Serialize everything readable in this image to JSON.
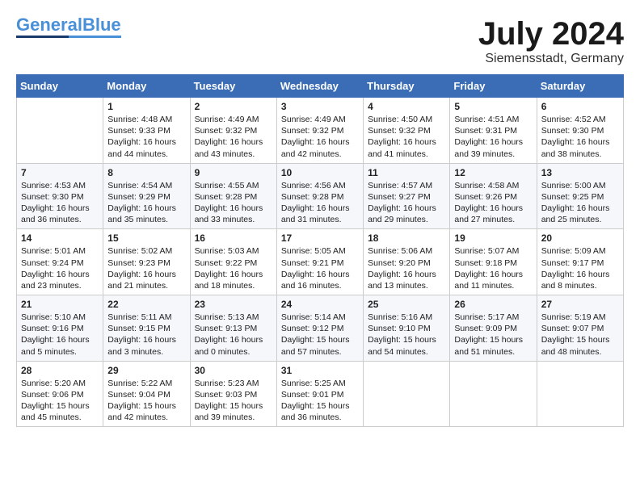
{
  "logo": {
    "part1": "General",
    "part2": "Blue"
  },
  "title": "July 2024",
  "location": "Siemensstadt, Germany",
  "headers": [
    "Sunday",
    "Monday",
    "Tuesday",
    "Wednesday",
    "Thursday",
    "Friday",
    "Saturday"
  ],
  "weeks": [
    [
      {
        "day": "",
        "lines": []
      },
      {
        "day": "1",
        "lines": [
          "Sunrise: 4:48 AM",
          "Sunset: 9:33 PM",
          "Daylight: 16 hours",
          "and 44 minutes."
        ]
      },
      {
        "day": "2",
        "lines": [
          "Sunrise: 4:49 AM",
          "Sunset: 9:32 PM",
          "Daylight: 16 hours",
          "and 43 minutes."
        ]
      },
      {
        "day": "3",
        "lines": [
          "Sunrise: 4:49 AM",
          "Sunset: 9:32 PM",
          "Daylight: 16 hours",
          "and 42 minutes."
        ]
      },
      {
        "day": "4",
        "lines": [
          "Sunrise: 4:50 AM",
          "Sunset: 9:32 PM",
          "Daylight: 16 hours",
          "and 41 minutes."
        ]
      },
      {
        "day": "5",
        "lines": [
          "Sunrise: 4:51 AM",
          "Sunset: 9:31 PM",
          "Daylight: 16 hours",
          "and 39 minutes."
        ]
      },
      {
        "day": "6",
        "lines": [
          "Sunrise: 4:52 AM",
          "Sunset: 9:30 PM",
          "Daylight: 16 hours",
          "and 38 minutes."
        ]
      }
    ],
    [
      {
        "day": "7",
        "lines": [
          "Sunrise: 4:53 AM",
          "Sunset: 9:30 PM",
          "Daylight: 16 hours",
          "and 36 minutes."
        ]
      },
      {
        "day": "8",
        "lines": [
          "Sunrise: 4:54 AM",
          "Sunset: 9:29 PM",
          "Daylight: 16 hours",
          "and 35 minutes."
        ]
      },
      {
        "day": "9",
        "lines": [
          "Sunrise: 4:55 AM",
          "Sunset: 9:28 PM",
          "Daylight: 16 hours",
          "and 33 minutes."
        ]
      },
      {
        "day": "10",
        "lines": [
          "Sunrise: 4:56 AM",
          "Sunset: 9:28 PM",
          "Daylight: 16 hours",
          "and 31 minutes."
        ]
      },
      {
        "day": "11",
        "lines": [
          "Sunrise: 4:57 AM",
          "Sunset: 9:27 PM",
          "Daylight: 16 hours",
          "and 29 minutes."
        ]
      },
      {
        "day": "12",
        "lines": [
          "Sunrise: 4:58 AM",
          "Sunset: 9:26 PM",
          "Daylight: 16 hours",
          "and 27 minutes."
        ]
      },
      {
        "day": "13",
        "lines": [
          "Sunrise: 5:00 AM",
          "Sunset: 9:25 PM",
          "Daylight: 16 hours",
          "and 25 minutes."
        ]
      }
    ],
    [
      {
        "day": "14",
        "lines": [
          "Sunrise: 5:01 AM",
          "Sunset: 9:24 PM",
          "Daylight: 16 hours",
          "and 23 minutes."
        ]
      },
      {
        "day": "15",
        "lines": [
          "Sunrise: 5:02 AM",
          "Sunset: 9:23 PM",
          "Daylight: 16 hours",
          "and 21 minutes."
        ]
      },
      {
        "day": "16",
        "lines": [
          "Sunrise: 5:03 AM",
          "Sunset: 9:22 PM",
          "Daylight: 16 hours",
          "and 18 minutes."
        ]
      },
      {
        "day": "17",
        "lines": [
          "Sunrise: 5:05 AM",
          "Sunset: 9:21 PM",
          "Daylight: 16 hours",
          "and 16 minutes."
        ]
      },
      {
        "day": "18",
        "lines": [
          "Sunrise: 5:06 AM",
          "Sunset: 9:20 PM",
          "Daylight: 16 hours",
          "and 13 minutes."
        ]
      },
      {
        "day": "19",
        "lines": [
          "Sunrise: 5:07 AM",
          "Sunset: 9:18 PM",
          "Daylight: 16 hours",
          "and 11 minutes."
        ]
      },
      {
        "day": "20",
        "lines": [
          "Sunrise: 5:09 AM",
          "Sunset: 9:17 PM",
          "Daylight: 16 hours",
          "and 8 minutes."
        ]
      }
    ],
    [
      {
        "day": "21",
        "lines": [
          "Sunrise: 5:10 AM",
          "Sunset: 9:16 PM",
          "Daylight: 16 hours",
          "and 5 minutes."
        ]
      },
      {
        "day": "22",
        "lines": [
          "Sunrise: 5:11 AM",
          "Sunset: 9:15 PM",
          "Daylight: 16 hours",
          "and 3 minutes."
        ]
      },
      {
        "day": "23",
        "lines": [
          "Sunrise: 5:13 AM",
          "Sunset: 9:13 PM",
          "Daylight: 16 hours",
          "and 0 minutes."
        ]
      },
      {
        "day": "24",
        "lines": [
          "Sunrise: 5:14 AM",
          "Sunset: 9:12 PM",
          "Daylight: 15 hours",
          "and 57 minutes."
        ]
      },
      {
        "day": "25",
        "lines": [
          "Sunrise: 5:16 AM",
          "Sunset: 9:10 PM",
          "Daylight: 15 hours",
          "and 54 minutes."
        ]
      },
      {
        "day": "26",
        "lines": [
          "Sunrise: 5:17 AM",
          "Sunset: 9:09 PM",
          "Daylight: 15 hours",
          "and 51 minutes."
        ]
      },
      {
        "day": "27",
        "lines": [
          "Sunrise: 5:19 AM",
          "Sunset: 9:07 PM",
          "Daylight: 15 hours",
          "and 48 minutes."
        ]
      }
    ],
    [
      {
        "day": "28",
        "lines": [
          "Sunrise: 5:20 AM",
          "Sunset: 9:06 PM",
          "Daylight: 15 hours",
          "and 45 minutes."
        ]
      },
      {
        "day": "29",
        "lines": [
          "Sunrise: 5:22 AM",
          "Sunset: 9:04 PM",
          "Daylight: 15 hours",
          "and 42 minutes."
        ]
      },
      {
        "day": "30",
        "lines": [
          "Sunrise: 5:23 AM",
          "Sunset: 9:03 PM",
          "Daylight: 15 hours",
          "and 39 minutes."
        ]
      },
      {
        "day": "31",
        "lines": [
          "Sunrise: 5:25 AM",
          "Sunset: 9:01 PM",
          "Daylight: 15 hours",
          "and 36 minutes."
        ]
      },
      {
        "day": "",
        "lines": []
      },
      {
        "day": "",
        "lines": []
      },
      {
        "day": "",
        "lines": []
      }
    ]
  ]
}
